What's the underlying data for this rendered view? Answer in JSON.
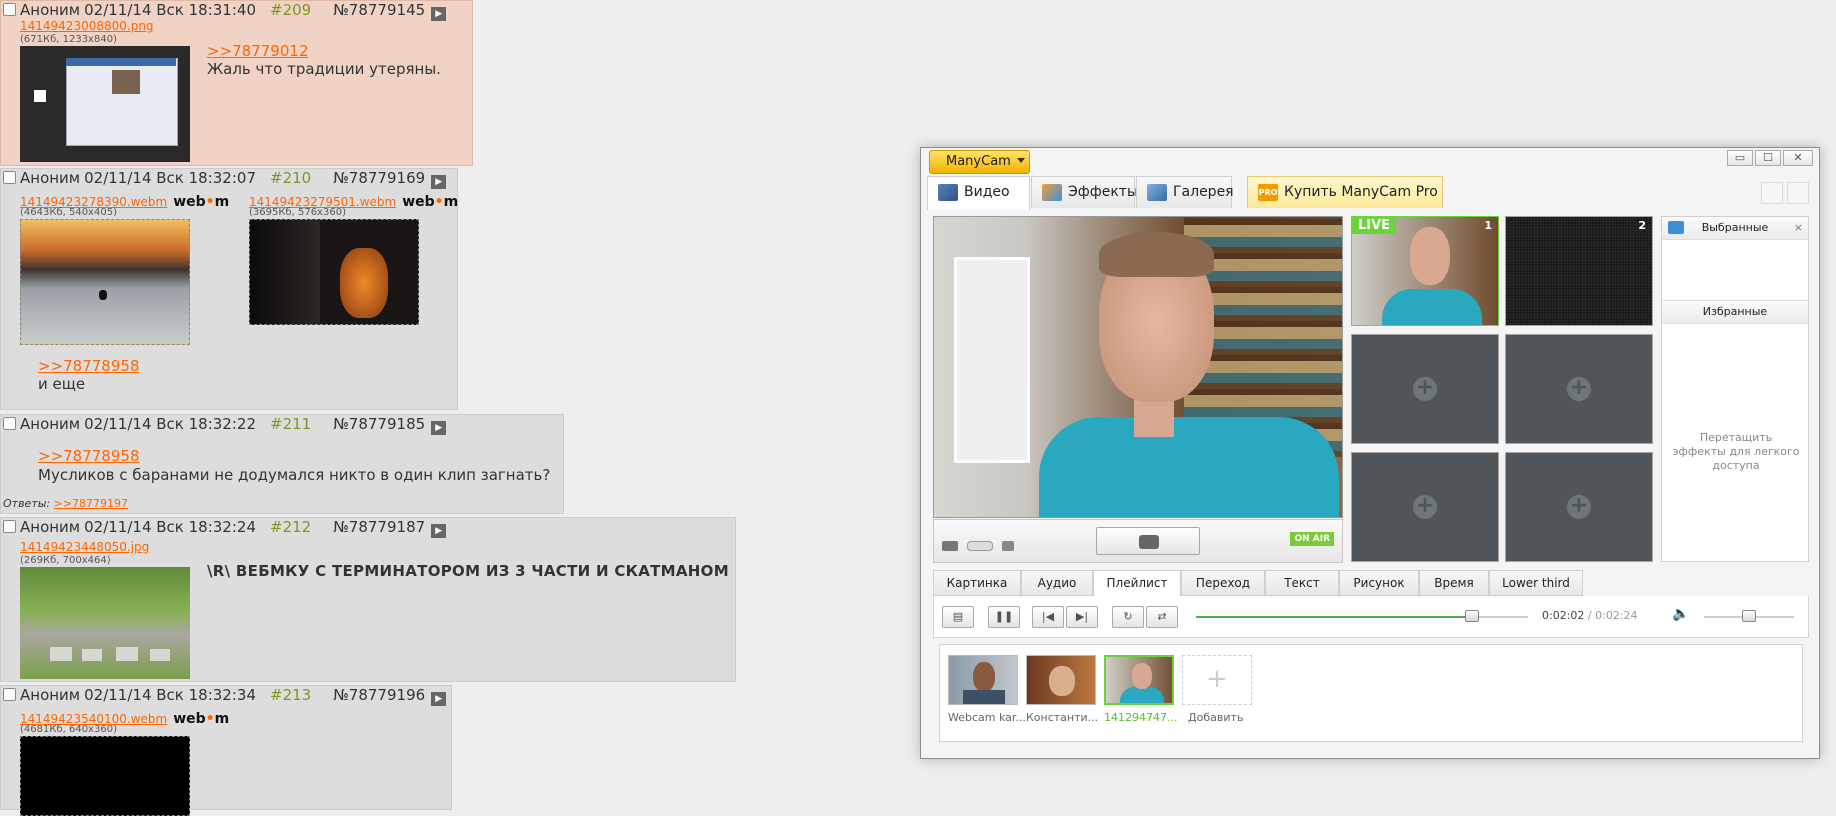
{
  "thread": {
    "posts": [
      {
        "name": "Аноним",
        "date": "02/11/14 Вск 18:31:40",
        "num": "#209",
        "id": "№78779145",
        "play": "▶",
        "files": [
          {
            "name": "14149423008800.png",
            "info": "(671Кб, 1233x840)",
            "webm": ""
          }
        ],
        "quote": ">>78779012",
        "message": "Жаль что традиции утеряны."
      },
      {
        "name": "Аноним",
        "date": "02/11/14 Вск 18:32:07",
        "num": "#210",
        "id": "№78779169",
        "play": "▶",
        "files": [
          {
            "name": "14149423278390.webm",
            "info": "(4643Кб, 540x405)",
            "webm_a": "web",
            "webm_dot": "•",
            "webm_b": "m"
          },
          {
            "name": "14149423279501.webm",
            "info": "(3695Кб, 576x360)",
            "webm_a": "web",
            "webm_dot": "•",
            "webm_b": "m"
          }
        ],
        "quote": ">>78778958",
        "message": "и еще"
      },
      {
        "name": "Аноним",
        "date": "02/11/14 Вск 18:32:22",
        "num": "#211",
        "id": "№78779185",
        "play": "▶",
        "quote": ">>78778958",
        "message": "Мусликов с баранами не додумался никто в один клип загнать?",
        "replies_label": "Ответы:",
        "replies_link": ">>78779197"
      },
      {
        "name": "Аноним",
        "date": "02/11/14 Вск 18:32:24",
        "num": "#212",
        "id": "№78779187",
        "play": "▶",
        "files": [
          {
            "name": "14149423448050.jpg",
            "info": "(269Кб, 700x464)"
          }
        ],
        "message": "\\R\\ ВЕБМКУ С ТЕРМИНАТОРОМ ИЗ 3 ЧАСТИ И СКАТМАНОМ"
      },
      {
        "name": "Аноним",
        "date": "02/11/14 Вск 18:32:34",
        "num": "#213",
        "id": "№78779196",
        "play": "▶",
        "files": [
          {
            "name": "14149423540100.webm",
            "info": "(4681Кб, 640x360)",
            "webm_a": "web",
            "webm_dot": "•",
            "webm_b": "m"
          }
        ]
      }
    ]
  },
  "manycam": {
    "menu_label": "ManyCam",
    "window_controls": {
      "minimize": "▭",
      "maximize": "☐",
      "close": "✕"
    },
    "tabs": [
      {
        "label": "Видео",
        "icon": "video-icon"
      },
      {
        "label": "Эффекты",
        "icon": "effects-icon"
      },
      {
        "label": "Галерея",
        "icon": "gallery-icon"
      },
      {
        "label": "Купить ManyCam Pro",
        "icon": "pro-icon",
        "icon_text": "PRO"
      }
    ],
    "live_label": "LIVE",
    "source_numbers": [
      "1",
      "2"
    ],
    "on_air": "ON AIR",
    "sidebar": {
      "selected_title": "Выбранные",
      "close": "×",
      "favorites_title": "Избранные",
      "hint": "Перетащить эффекты для легкого доступа"
    },
    "panel_tabs": [
      "Картинка",
      "Аудио",
      "Плейлист",
      "Переход",
      "Текст",
      "Рисунок",
      "Время",
      "Lower third"
    ],
    "active_panel_tab": "Плейлист",
    "playback": {
      "buttons": [
        "▤",
        "❚❚",
        "|◀",
        "▶|",
        "↻",
        "⇄"
      ],
      "current_time": "0:02:02",
      "separator": " / ",
      "total_time": "0:02:24",
      "progress": 0.83,
      "volume": 0.5,
      "volume_icon": "🔈"
    },
    "playlist": [
      {
        "label": "Webcam kar..."
      },
      {
        "label": "Константи..."
      },
      {
        "label": "141294747...",
        "selected": true
      }
    ],
    "add_label": "Добавить",
    "add_glyph": "+"
  }
}
